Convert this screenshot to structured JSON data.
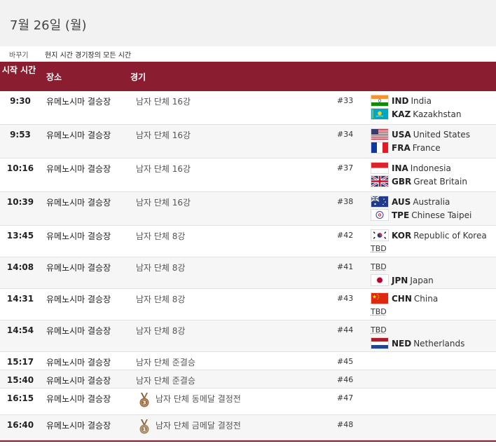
{
  "page": {
    "title": "7월 26일 (월)"
  },
  "toggle": {
    "label": "바꾸기",
    "option": "현지 시간 경기장의 모든 시간"
  },
  "table": {
    "headers": {
      "time": "시작 시간",
      "venue": "장소",
      "event": "경기"
    },
    "rows": [
      {
        "time": "9:30",
        "venue": "유메노시마 결승장",
        "event": "남자 단체 16강",
        "num": "#33",
        "teams": [
          {
            "code": "IND",
            "name": "India",
            "flag": "ind-flag"
          },
          {
            "code": "KAZ",
            "name": "Kazakhstan",
            "flag": "kaz-flag"
          }
        ]
      },
      {
        "time": "9:53",
        "venue": "유메노시마 결승장",
        "event": "남자 단체 16강",
        "num": "#34",
        "teams": [
          {
            "code": "USA",
            "name": "United States",
            "flag": "usa-flag"
          },
          {
            "code": "FRA",
            "name": "France",
            "flag": "fra-flag"
          }
        ]
      },
      {
        "time": "10:16",
        "venue": "유메노시마 결승장",
        "event": "남자 단체 16강",
        "num": "#37",
        "teams": [
          {
            "code": "INA",
            "name": "Indonesia",
            "flag": "ina-flag"
          },
          {
            "code": "GBR",
            "name": "Great Britain",
            "flag": "gbr-flag"
          }
        ]
      },
      {
        "time": "10:39",
        "venue": "유메노시마 결승장",
        "event": "남자 단체 16강",
        "num": "#38",
        "teams": [
          {
            "code": "AUS",
            "name": "Australia",
            "flag": "aus-flag"
          },
          {
            "code": "TPE",
            "name": "Chinese Taipei",
            "flag": "tpe-flag"
          }
        ]
      },
      {
        "time": "13:45",
        "venue": "유메노시마 결승장",
        "event": "남자 단체 8강",
        "num": "#42",
        "teams": [
          {
            "code": "KOR",
            "name": "Republic of Korea",
            "flag": "kor-flag"
          },
          {
            "tbd": "TBD"
          }
        ]
      },
      {
        "time": "14:08",
        "venue": "유메노시마 결승장",
        "event": "남자 단체 8강",
        "num": "#41",
        "teams": [
          {
            "tbd": "TBD"
          },
          {
            "code": "JPN",
            "name": "Japan",
            "flag": "jpn-flag"
          }
        ]
      },
      {
        "time": "14:31",
        "venue": "유메노시마 결승장",
        "event": "남자 단체 8강",
        "num": "#43",
        "teams": [
          {
            "code": "CHN",
            "name": "China",
            "flag": "chn-flag"
          },
          {
            "tbd": "TBD"
          }
        ]
      },
      {
        "time": "14:54",
        "venue": "유메노시마 결승장",
        "event": "남자 단체 8강",
        "num": "#44",
        "teams": [
          {
            "tbd": "TBD"
          },
          {
            "code": "NED",
            "name": "Netherlands",
            "flag": "ned-flag"
          }
        ]
      },
      {
        "time": "15:17",
        "venue": "유메노시마 결승장",
        "event": "남자 단체 준결승",
        "num": "#45",
        "teams": []
      },
      {
        "time": "15:40",
        "venue": "유메노시마 결승장",
        "event": "남자 단체 준결승",
        "num": "#46",
        "teams": []
      },
      {
        "time": "16:15",
        "venue": "유메노시마 결승장",
        "event": "남자 단체 동메달 결정전",
        "num": "#47",
        "medal": "bronze-medal-icon",
        "teams": []
      },
      {
        "time": "16:40",
        "venue": "유메노시마 결승장",
        "event": "남자 단체 금메달 결정전",
        "num": "#48",
        "medal": "gold-medal-icon",
        "teams": []
      }
    ]
  },
  "colors": {
    "header_bg": "#8b1d30",
    "bronze": "#9c6b3e",
    "gold": "#a0825a"
  }
}
